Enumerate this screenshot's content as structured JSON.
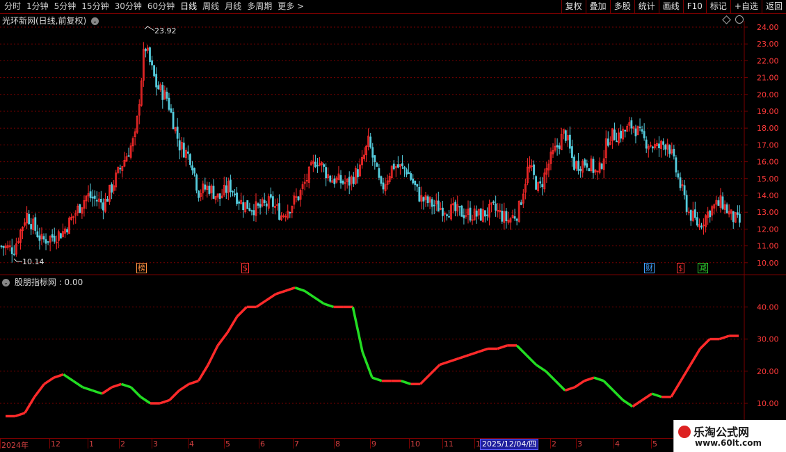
{
  "toolbar": {
    "left_items": [
      "分时",
      "1分钟",
      "5分钟",
      "15分钟",
      "30分钟",
      "60分钟",
      "日线",
      "周线",
      "月线",
      "多周期",
      "更多 >"
    ],
    "active": "日线",
    "right_items": [
      "复权",
      "叠加",
      "多股",
      "统计",
      "画线",
      "F10",
      "标记",
      "+自选",
      "返回"
    ]
  },
  "main_chart": {
    "title": "光环新网(日线,前复权)",
    "high_label": "23.92",
    "low_label": "10.14",
    "y_ticks": [
      "24.00",
      "23.00",
      "22.00",
      "21.00",
      "20.00",
      "19.00",
      "18.00",
      "17.00",
      "16.00",
      "15.00",
      "14.00",
      "13.00",
      "12.00",
      "11.00",
      "10.00"
    ],
    "markers": [
      {
        "text": "榜",
        "color": "#ff9040"
      },
      {
        "text": "$",
        "color": "#ff3030"
      },
      {
        "text": "财",
        "color": "#40a0ff"
      },
      {
        "text": "$",
        "color": "#ff3030"
      },
      {
        "text": "减",
        "color": "#30d030"
      }
    ]
  },
  "indicator": {
    "title": "股朋指标网 : 0.00",
    "y_ticks": [
      "40.00",
      "30.00",
      "20.00",
      "10.00"
    ]
  },
  "date_axis": {
    "labels": [
      "2024年",
      "12",
      "1",
      "2",
      "3",
      "4",
      "5",
      "6",
      "7",
      "8",
      "9",
      "10",
      "11",
      "1",
      "2",
      "3",
      "4",
      "5"
    ],
    "cursor_label": "2025/12/04/四"
  },
  "colors": {
    "up": "#ff2a2a",
    "down": "#22dd22",
    "candle_down": "#55ccdd",
    "grid": "#7a0000",
    "axis_text": "#ff3a3a"
  },
  "watermark": {
    "title": "乐淘公式网",
    "url": "www.60lt.com"
  },
  "chart_data": {
    "type": "line",
    "title": "股朋指标网",
    "ylim": [
      5,
      48
    ],
    "y_ticks": [
      10,
      20,
      30,
      40
    ],
    "series": [
      {
        "values": [
          6,
          6,
          7,
          12,
          16,
          18,
          19,
          17,
          15,
          14,
          13,
          15,
          16,
          15,
          12,
          10,
          10,
          11,
          14,
          16,
          17,
          22,
          28,
          32,
          37,
          40,
          40,
          42,
          44,
          45,
          46,
          45,
          43,
          41,
          40,
          40,
          40,
          26,
          18,
          17,
          17,
          17,
          16,
          16,
          19,
          22,
          23,
          24,
          25,
          26,
          27,
          27,
          28,
          28,
          25,
          22,
          20,
          17,
          14,
          15,
          17,
          18,
          17,
          14,
          11,
          9,
          11,
          13,
          12,
          12,
          17,
          22,
          27,
          30,
          30,
          31,
          31
        ]
      }
    ]
  }
}
